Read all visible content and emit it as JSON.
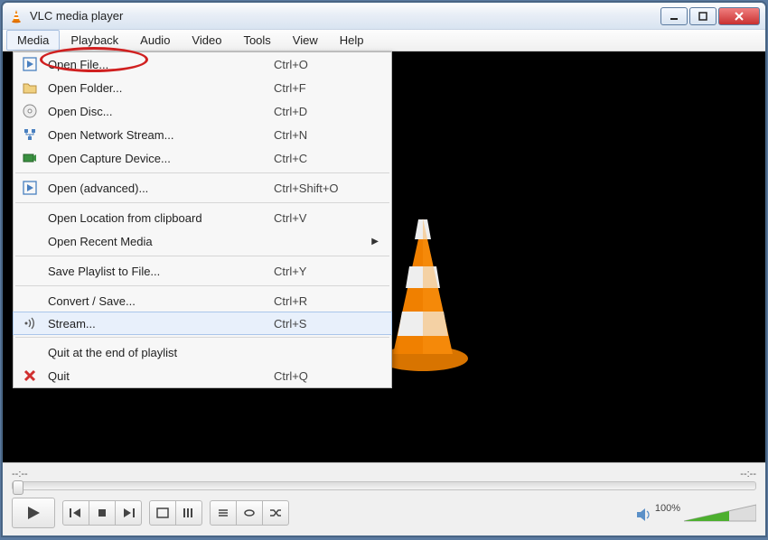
{
  "titlebar": {
    "title": "VLC media player"
  },
  "menubar": {
    "items": [
      "Media",
      "Playback",
      "Audio",
      "Video",
      "Tools",
      "View",
      "Help"
    ],
    "active_index": 0
  },
  "dropdown": {
    "items": [
      {
        "icon": "play-file-icon",
        "label": "Open File...",
        "shortcut": "Ctrl+O",
        "highlighted": true
      },
      {
        "icon": "folder-icon",
        "label": "Open Folder...",
        "shortcut": "Ctrl+F"
      },
      {
        "icon": "disc-icon",
        "label": "Open Disc...",
        "shortcut": "Ctrl+D"
      },
      {
        "icon": "network-icon",
        "label": "Open Network Stream...",
        "shortcut": "Ctrl+N"
      },
      {
        "icon": "capture-icon",
        "label": "Open Capture Device...",
        "shortcut": "Ctrl+C"
      },
      {
        "sep": true
      },
      {
        "icon": "play-file-icon",
        "label": "Open (advanced)...",
        "shortcut": "Ctrl+Shift+O"
      },
      {
        "sep": true
      },
      {
        "icon": "",
        "label": "Open Location from clipboard",
        "shortcut": "Ctrl+V"
      },
      {
        "icon": "",
        "label": "Open Recent Media",
        "submenu": true
      },
      {
        "sep": true
      },
      {
        "icon": "",
        "label": "Save Playlist to File...",
        "shortcut": "Ctrl+Y"
      },
      {
        "sep": true
      },
      {
        "icon": "",
        "label": "Convert / Save...",
        "shortcut": "Ctrl+R"
      },
      {
        "icon": "stream-icon",
        "label": "Stream...",
        "shortcut": "Ctrl+S",
        "hover": true
      },
      {
        "sep": true
      },
      {
        "icon": "",
        "label": "Quit at the end of playlist"
      },
      {
        "icon": "quit-icon",
        "label": "Quit",
        "shortcut": "Ctrl+Q"
      }
    ]
  },
  "time": {
    "left": "--:--",
    "right": "--:--"
  },
  "volume": {
    "percent": "100%"
  }
}
